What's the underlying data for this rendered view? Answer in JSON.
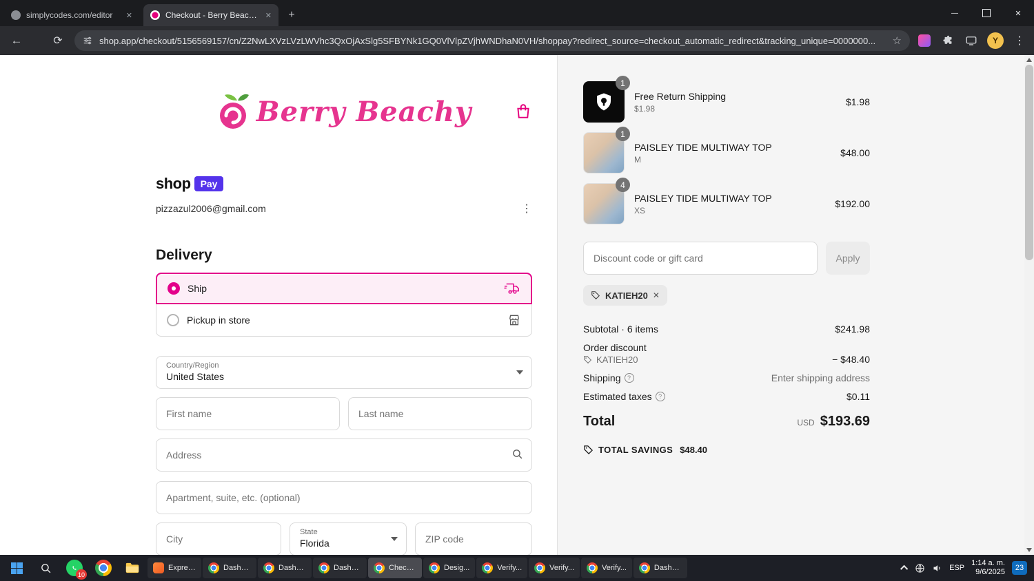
{
  "browser": {
    "tab1": {
      "title": "simplycodes.com/editor"
    },
    "tab2": {
      "title": "Checkout - Berry Beachy Swim..."
    },
    "url": "shop.app/checkout/5156569157/cn/Z2NwLXVzLVzLWVhc3QxOjAxSlg5SFBYNk1GQ0VlVlpZVjhWNDhaN0VH/shoppay?redirect_source=checkout_automatic_redirect&tracking_unique=0000000...",
    "avatar_initial": "Y"
  },
  "checkout": {
    "brand": "Berry Beachy",
    "shop_pay": {
      "shop": "shop",
      "pay": "Pay"
    },
    "email": "pizzazul2006@gmail.com",
    "delivery": {
      "heading": "Delivery",
      "ship_label": "Ship",
      "pickup_label": "Pickup in store"
    },
    "address_form": {
      "country_label": "Country/Region",
      "country_value": "United States",
      "first_name_placeholder": "First name",
      "last_name_placeholder": "Last name",
      "address_placeholder": "Address",
      "apartment_placeholder": "Apartment, suite, etc. (optional)",
      "city_placeholder": "City",
      "state_label": "State",
      "state_value": "Florida",
      "zip_placeholder": "ZIP code"
    }
  },
  "summary": {
    "items": [
      {
        "qty": "1",
        "title": "Free Return Shipping",
        "variant": "$1.98",
        "price": "$1.98"
      },
      {
        "qty": "1",
        "title": "PAISLEY TIDE MULTIWAY TOP",
        "variant": "M",
        "price": "$48.00"
      },
      {
        "qty": "4",
        "title": "PAISLEY TIDE MULTIWAY TOP",
        "variant": "XS",
        "price": "$192.00"
      }
    ],
    "discount_placeholder": "Discount code or gift card",
    "apply_label": "Apply",
    "discount_chip": "KATIEH20",
    "subtotal_label": "Subtotal · 6 items",
    "subtotal_value": "$241.98",
    "order_discount_label": "Order discount",
    "order_discount_code": "KATIEH20",
    "order_discount_value": "− $48.40",
    "shipping_label": "Shipping",
    "shipping_value": "Enter shipping address",
    "taxes_label": "Estimated taxes",
    "taxes_value": "$0.11",
    "total_label": "Total",
    "currency": "USD",
    "total_value": "$193.69",
    "savings_label": "TOTAL SAVINGS",
    "savings_value": "$48.40"
  },
  "taskbar": {
    "whatsapp_badge": "10",
    "apps": [
      {
        "label": "Expres..."
      },
      {
        "label": "Dashb..."
      },
      {
        "label": "Dashb..."
      },
      {
        "label": "Dashb..."
      },
      {
        "label": "Check..."
      },
      {
        "label": "Desig..."
      },
      {
        "label": "Verify..."
      },
      {
        "label": "Verify..."
      },
      {
        "label": "Verify..."
      },
      {
        "label": "Dashb..."
      }
    ],
    "lang": "ESP",
    "time": "1:14 a. m.",
    "date": "9/6/2025",
    "notif_count": "23"
  },
  "colors": {
    "accent_pink": "#e3018a",
    "shop_pay_purple": "#5433eb",
    "summary_bg": "#f5f5f5",
    "taskbar_bg": "#1d1f26"
  }
}
